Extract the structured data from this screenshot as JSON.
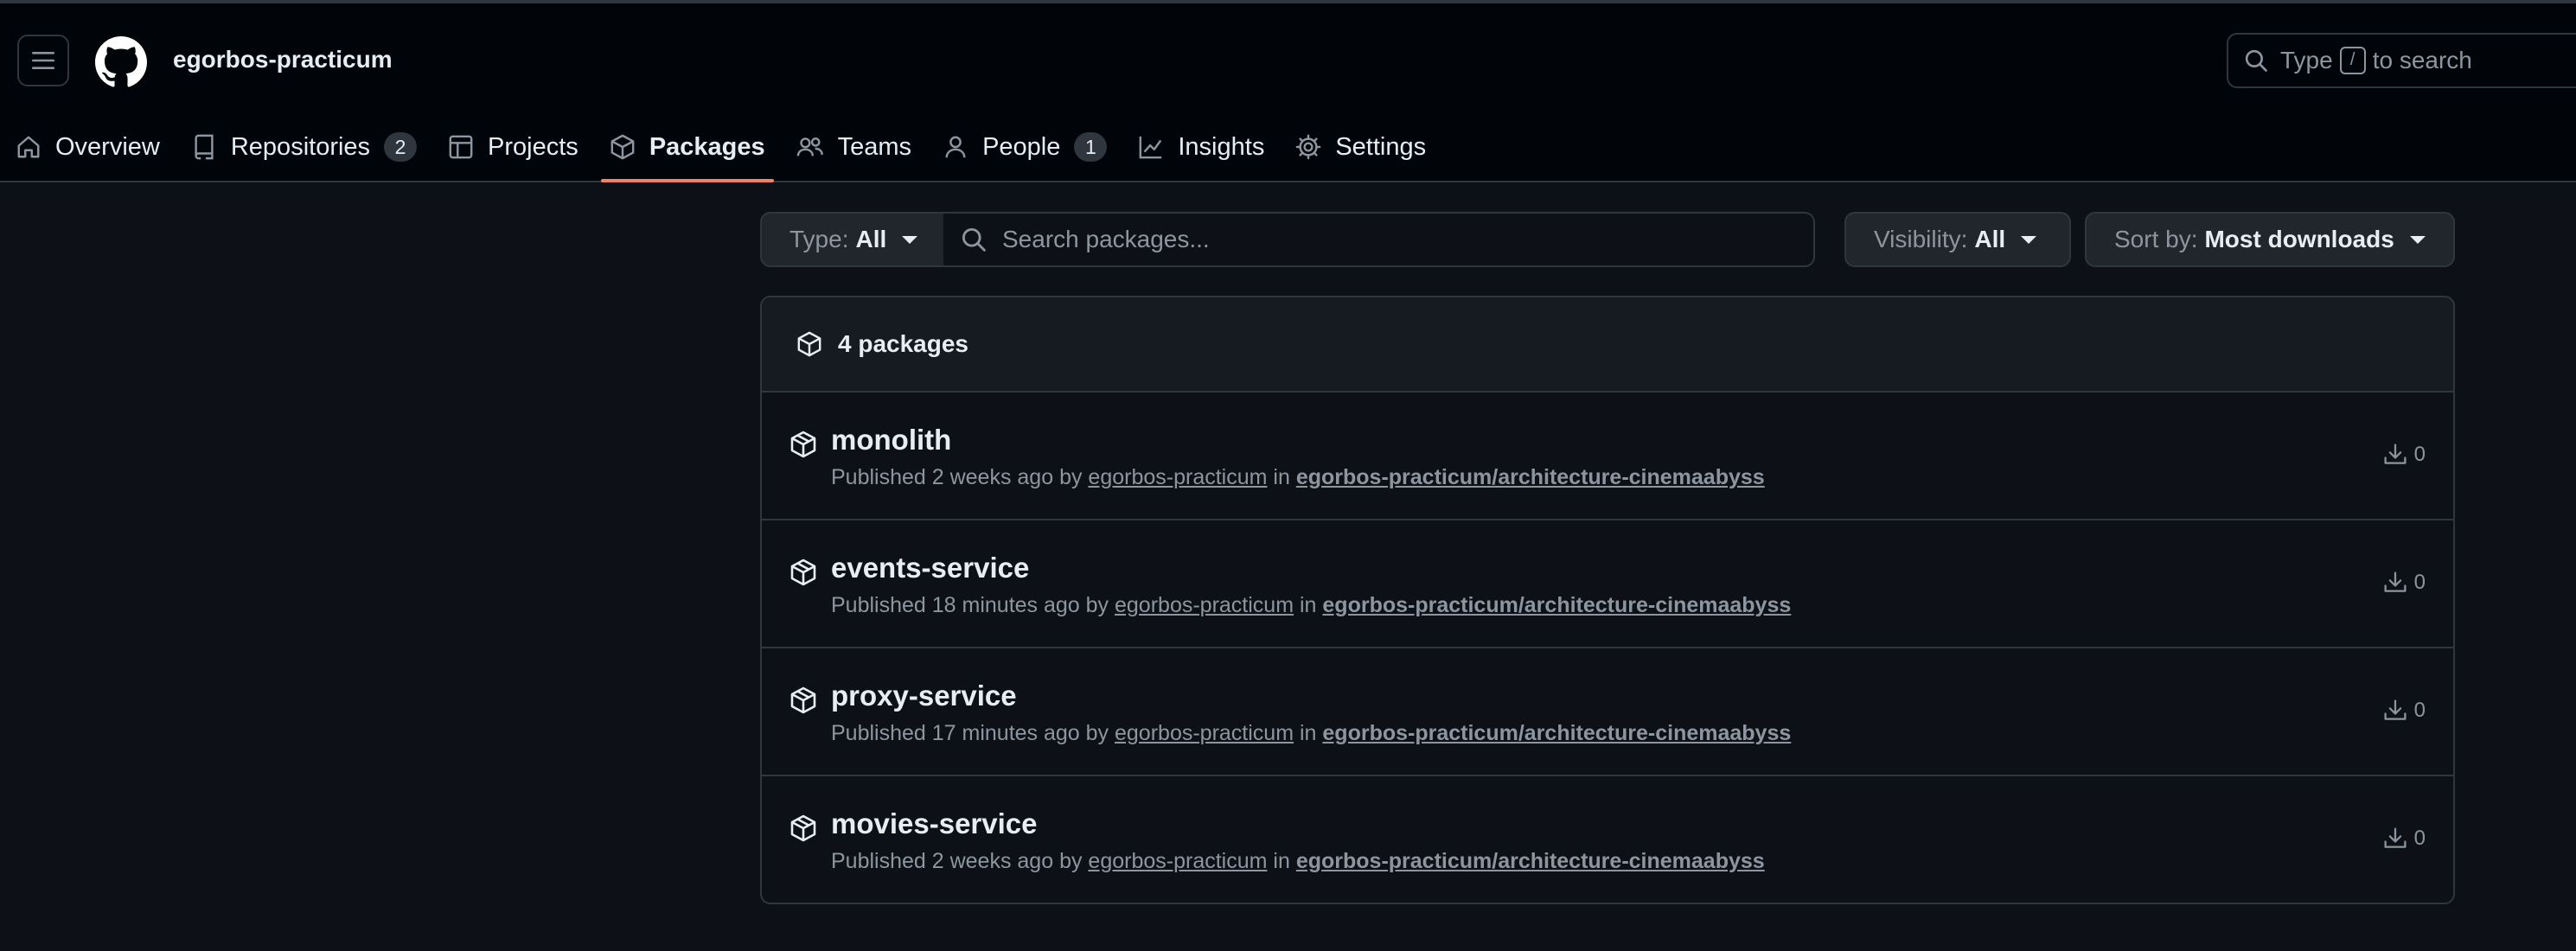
{
  "header": {
    "org_name": "egorbos-practicum",
    "search_prefix": "Type",
    "search_key": "/",
    "search_suffix": "to search"
  },
  "nav": [
    {
      "label": "Overview",
      "icon": "home-icon"
    },
    {
      "label": "Repositories",
      "icon": "repo-icon",
      "count": "2"
    },
    {
      "label": "Projects",
      "icon": "table-icon"
    },
    {
      "label": "Packages",
      "icon": "package-icon",
      "active": true
    },
    {
      "label": "Teams",
      "icon": "people-icon"
    },
    {
      "label": "People",
      "icon": "person-icon",
      "count": "1"
    },
    {
      "label": "Insights",
      "icon": "graph-icon"
    },
    {
      "label": "Settings",
      "icon": "gear-icon"
    }
  ],
  "filters": {
    "type_label": "Type:",
    "type_value": "All",
    "search_placeholder": "Search packages...",
    "visibility_label": "Visibility:",
    "visibility_value": "All",
    "sort_label": "Sort by:",
    "sort_value": "Most downloads"
  },
  "packages_header": "4 packages",
  "packages": [
    {
      "name": "monolith",
      "published": "Published 2 weeks ago by",
      "user": "egorbos-practicum",
      "in": "in",
      "repo": "egorbos-practicum/architecture-cinemaabyss",
      "downloads": "0"
    },
    {
      "name": "events-service",
      "published": "Published 18 minutes ago by",
      "user": "egorbos-practicum",
      "in": "in",
      "repo": "egorbos-practicum/architecture-cinemaabyss",
      "downloads": "0"
    },
    {
      "name": "proxy-service",
      "published": "Published 17 minutes ago by",
      "user": "egorbos-practicum",
      "in": "in",
      "repo": "egorbos-practicum/architecture-cinemaabyss",
      "downloads": "0"
    },
    {
      "name": "movies-service",
      "published": "Published 2 weeks ago by",
      "user": "egorbos-practicum",
      "in": "in",
      "repo": "egorbos-practicum/architecture-cinemaabyss",
      "downloads": "0"
    }
  ],
  "colors": {
    "background": "#0d1117",
    "header_bg": "#010409",
    "border": "#30363d",
    "accent_underline": "#f78166",
    "muted_text": "#8d96a0"
  }
}
